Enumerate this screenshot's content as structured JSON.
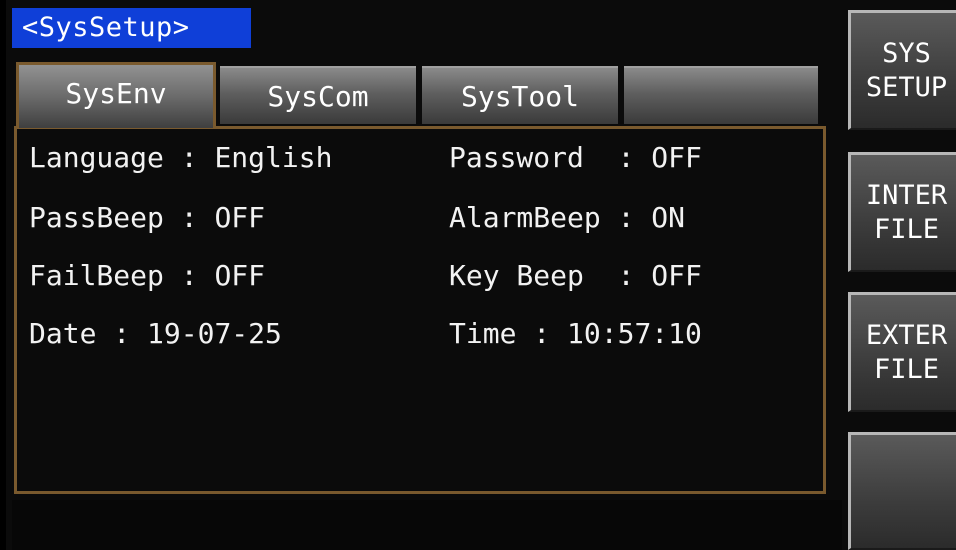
{
  "header": {
    "title": "<SysSetup>"
  },
  "tabs": [
    {
      "label": "SysEnv",
      "active": true
    },
    {
      "label": "SysCom",
      "active": false
    },
    {
      "label": "SysTool",
      "active": false
    },
    {
      "label": "",
      "active": false
    }
  ],
  "settings": {
    "language": {
      "label": "Language",
      "value": "English"
    },
    "password": {
      "label": "Password",
      "value": "OFF"
    },
    "pass_beep": {
      "label": "PassBeep",
      "value": "OFF"
    },
    "alarm_beep": {
      "label": "AlarmBeep",
      "value": "ON"
    },
    "fail_beep": {
      "label": "FailBeep",
      "value": "OFF"
    },
    "key_beep": {
      "label": "Key Beep",
      "value": "OFF"
    },
    "date": {
      "label": "Date",
      "value": "19-07-25"
    },
    "time": {
      "label": "Time",
      "value": "10:57:10"
    }
  },
  "softkeys": [
    {
      "line1": "SYS",
      "line2": "SETUP"
    },
    {
      "line1": "INTER",
      "line2": "FILE"
    },
    {
      "line1": "EXTER",
      "line2": "FILE"
    },
    {
      "line1": "",
      "line2": ""
    }
  ],
  "colors": {
    "title_bg": "#0f3fd8",
    "panel_border": "#7a5a2e",
    "background": "#0b0b0b"
  }
}
